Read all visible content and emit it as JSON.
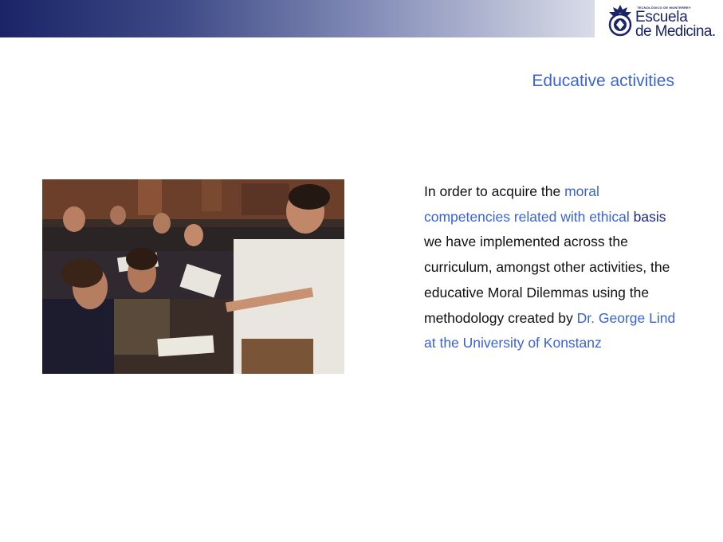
{
  "header": {
    "logo": {
      "institution_small": "TECNOLÓGICO DE MONTERREY",
      "line1": "Escuela",
      "line2": "de Medicina."
    }
  },
  "slide": {
    "title": "Educative activities",
    "photo_icon": "classroom-photo-icon",
    "body": {
      "seg1": "In order to acquire the ",
      "seg2": "moral competencies related with ethical",
      "seg3": " ",
      "seg4": "basis",
      "seg5": " we have implemented across the curriculum, amongst  other activities, the educative Moral Dilemmas using the methodology created by ",
      "seg6": "Dr. George Lind at the University of  Konstanz"
    }
  },
  "colors": {
    "title": "#3a63d6",
    "highlight_light": "#3a63d6",
    "highlight_dark": "#1a2a80",
    "bar_dark": "#1a2467",
    "bar_light": "#d9dce8"
  }
}
